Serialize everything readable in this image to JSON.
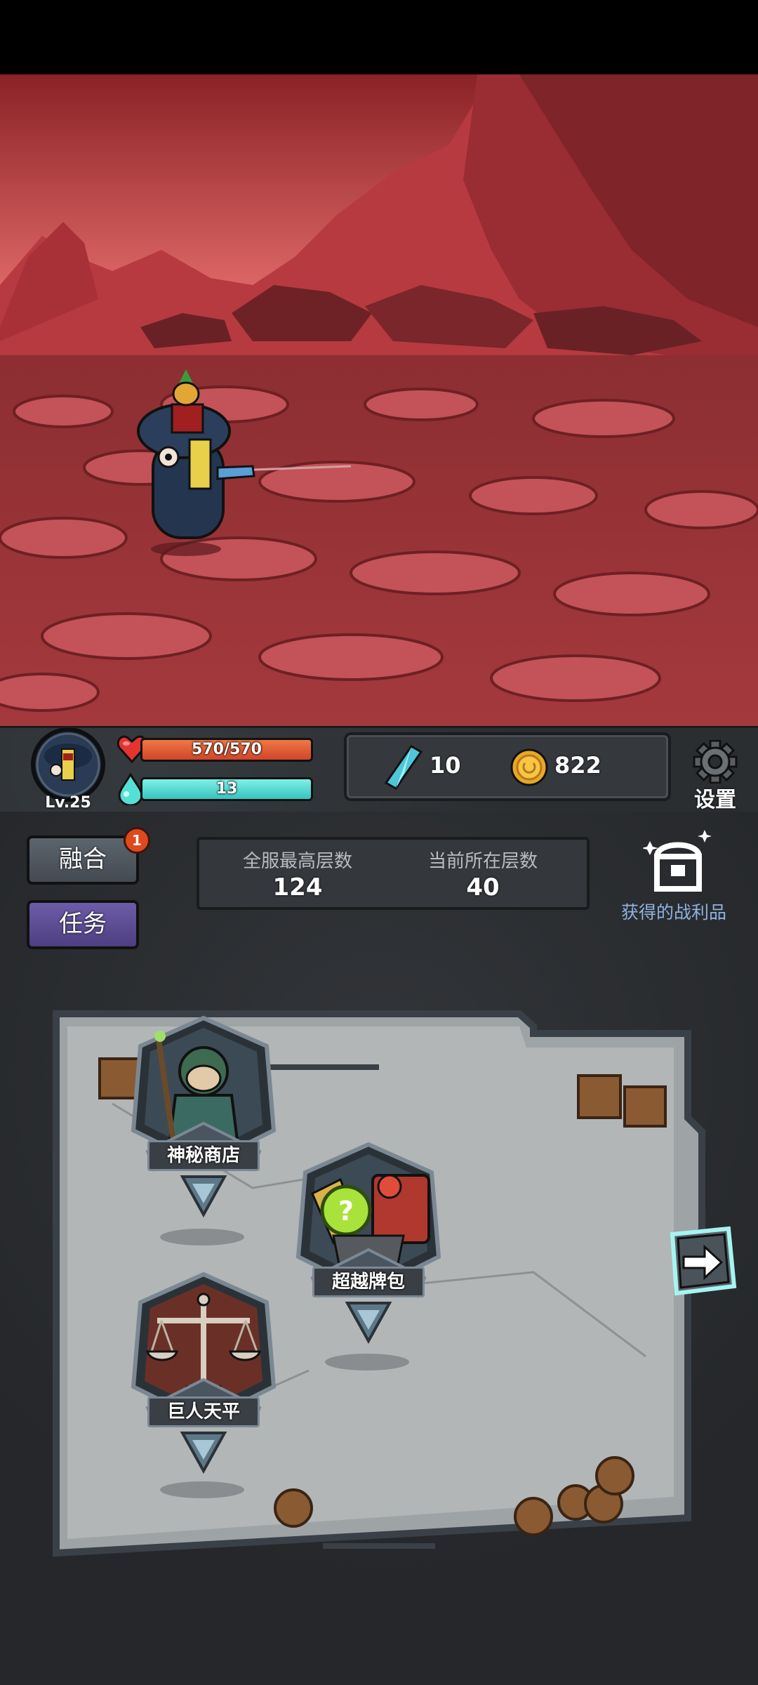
{
  "player": {
    "level": "Lv.25",
    "hp_text": "570/570",
    "hp_fraction": 1.0,
    "mp_text": "13",
    "mp_fraction": 1.0
  },
  "currency": {
    "gems": "10",
    "coins": "822"
  },
  "settings": {
    "label": "设置"
  },
  "menu": {
    "fusion_label": "融合",
    "fusion_badge": "1",
    "quest_label": "任务"
  },
  "floors": {
    "server_best_label": "全服最高层数",
    "server_best_value": "124",
    "current_label": "当前所在层数",
    "current_value": "40"
  },
  "loot": {
    "label": "获得的战利品"
  },
  "rooms": {
    "shop_label": "神秘商店",
    "pack_label": "超越牌包",
    "scale_label": "巨人天平"
  },
  "icons": {
    "hp": "heart-icon",
    "mp": "mana-droplet-icon",
    "gem": "crystal-gem-icon",
    "coin": "gold-coin-icon",
    "settings": "gear-icon",
    "loot": "treasure-chest-icon",
    "next": "arrow-right-icon"
  },
  "colors": {
    "hp": "#e45a33",
    "mp": "#4fd8d2",
    "quest_button": "#5a4a8c",
    "fusion_button": "#4c535b",
    "loot_text": "#8fb2e0",
    "badge": "#e0481e"
  }
}
